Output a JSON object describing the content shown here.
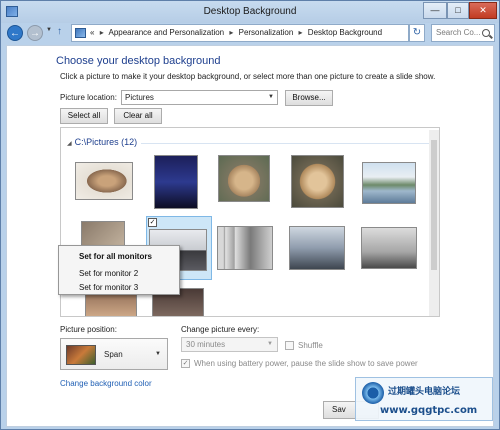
{
  "window": {
    "title": "Desktop Background"
  },
  "navbar": {
    "breadcrumb": [
      "Appearance and Personalization",
      "Personalization",
      "Desktop Background"
    ],
    "breadcrumb_prefix": "«",
    "search_placeholder": "Search Co..."
  },
  "main": {
    "heading": "Choose your desktop background",
    "instructions": "Click a picture to make it your desktop background, or select more than one picture to create a slide show.",
    "picture_location_label": "Picture location:",
    "picture_location_value": "Pictures",
    "browse_label": "Browse...",
    "select_all_label": "Select all",
    "clear_all_label": "Clear all"
  },
  "gallery": {
    "group_header": "C:\\Pictures (12)",
    "selected_checkbox": "✓"
  },
  "context_menu": {
    "items": [
      "Set for all monitors",
      "Set for monitor 2",
      "Set for monitor 3"
    ]
  },
  "position": {
    "label": "Picture position:",
    "value": "Span"
  },
  "slideshow": {
    "interval_label": "Change picture every:",
    "interval_value": "30 minutes",
    "shuffle_label": "Shuffle",
    "battery_label": "When using battery power, pause the slide show to save power",
    "battery_checked": "✓"
  },
  "footer": {
    "change_bg_color_link": "Change background color",
    "save_label": "Sav"
  },
  "watermark": {
    "line1": "过期罐头电脑论坛",
    "line2": "www.gqgtpc.com"
  },
  "colors": {
    "accent": "#1e3f8e",
    "link": "#1f5fb4",
    "selection": "#cde6f7"
  }
}
